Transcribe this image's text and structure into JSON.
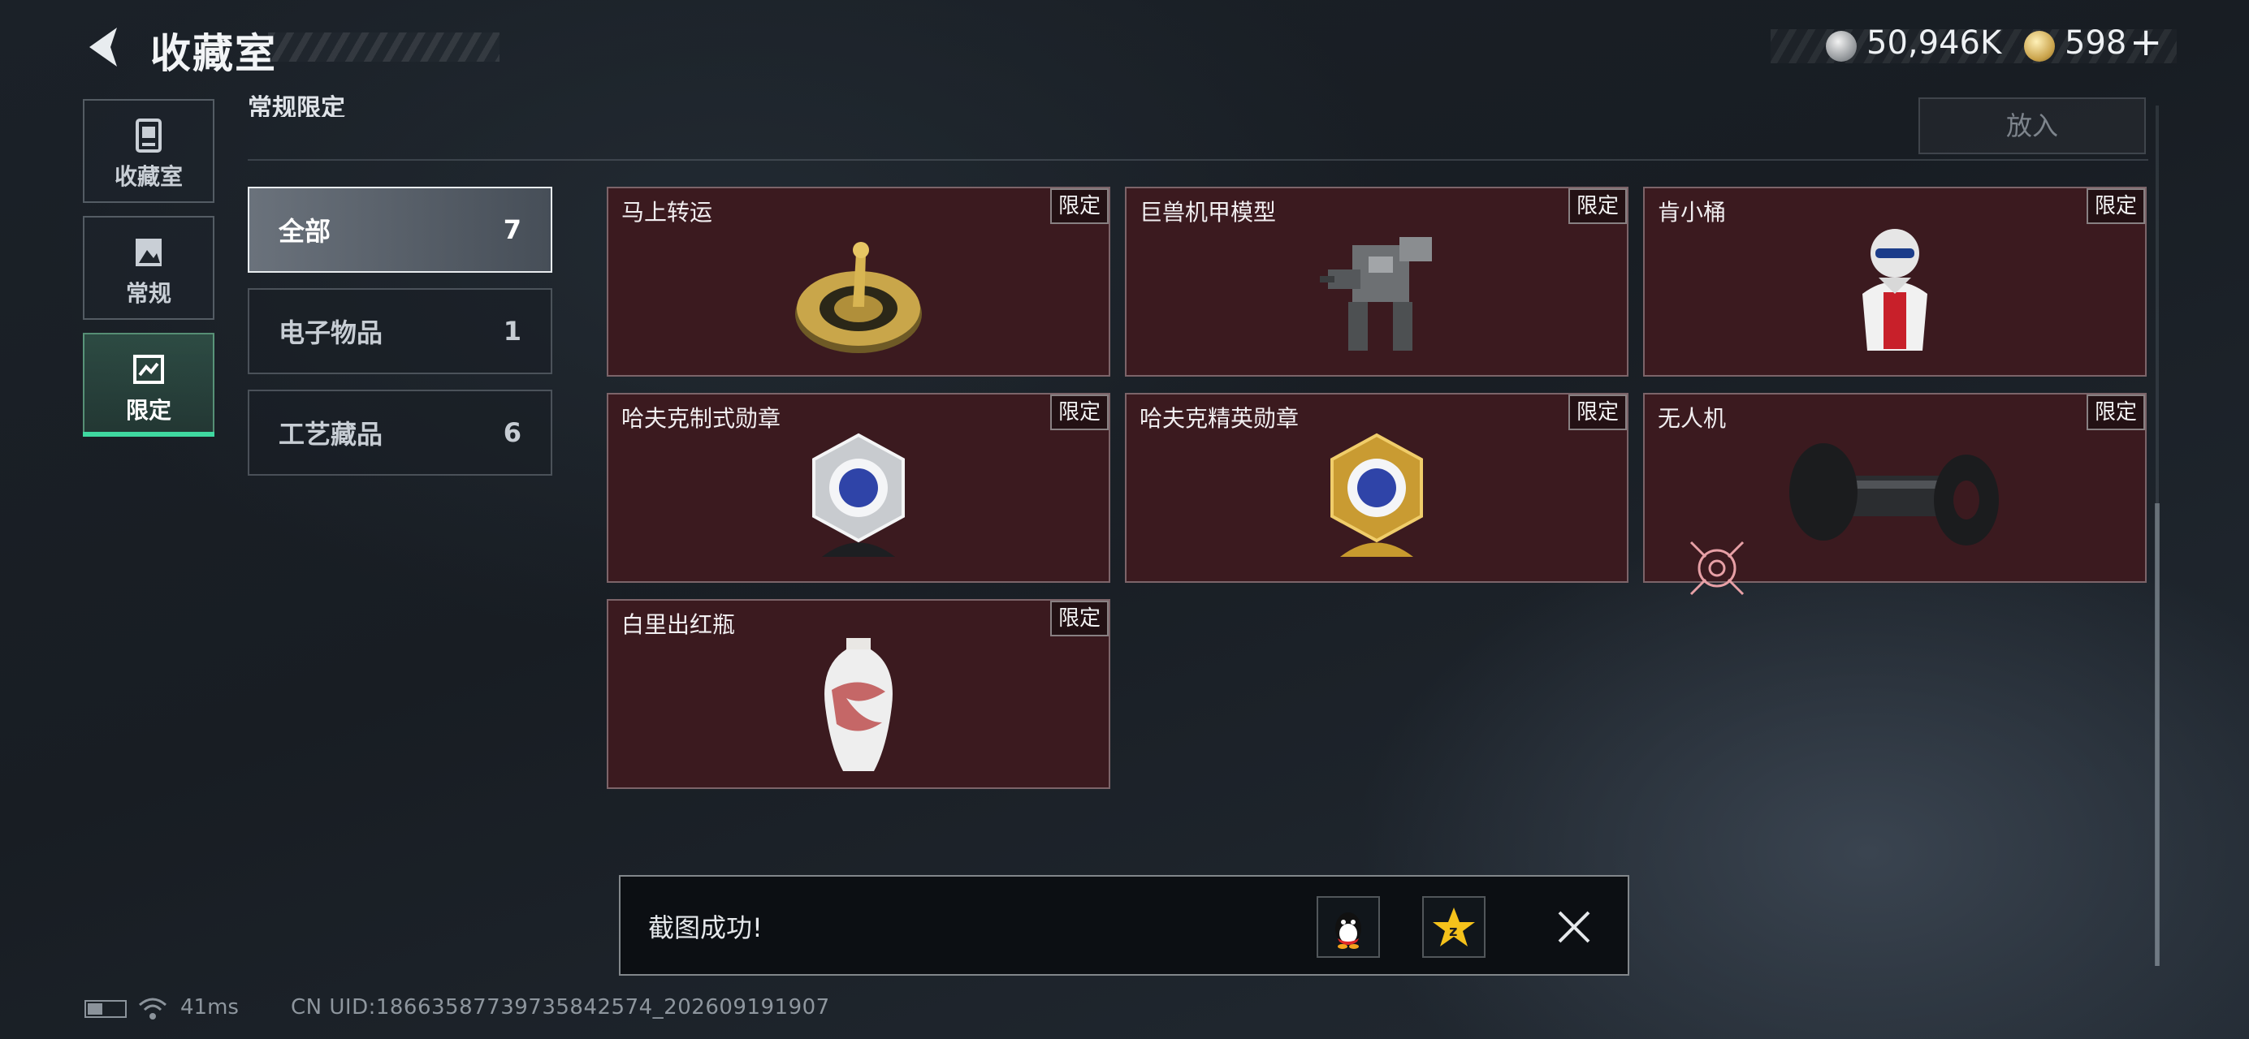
{
  "header": {
    "title": "收藏室",
    "currency": {
      "silver": "50,946K",
      "gold": "598",
      "plus": "+"
    }
  },
  "nav": [
    {
      "label": "收藏室"
    },
    {
      "label": "常规"
    },
    {
      "label": "限定"
    }
  ],
  "section": {
    "title": "常规限定",
    "put_label": "放入"
  },
  "categories": [
    {
      "label": "全部",
      "count": "7"
    },
    {
      "label": "电子物品",
      "count": "1"
    },
    {
      "label": "工艺藏品",
      "count": "6"
    }
  ],
  "items": [
    {
      "name": "马上转运",
      "tag": "限定",
      "icon": "golden-compass-icon"
    },
    {
      "name": "巨兽机甲模型",
      "tag": "限定",
      "icon": "mech-model-icon"
    },
    {
      "name": "肯小桶",
      "tag": "限定",
      "icon": "colonel-figure-icon"
    },
    {
      "name": "哈夫克制式勋章",
      "tag": "限定",
      "icon": "silver-medal-icon"
    },
    {
      "name": "哈夫克精英勋章",
      "tag": "限定",
      "icon": "gold-medal-icon"
    },
    {
      "name": "无人机",
      "tag": "限定",
      "icon": "drone-icon"
    },
    {
      "name": "白里出红瓶",
      "tag": "限定",
      "icon": "porcelain-vase-icon"
    }
  ],
  "toast": {
    "message": "截图成功!"
  },
  "status": {
    "ping": "41ms",
    "uid": "CN UID:1866358773973584257­4_202609191907"
  },
  "colors": {
    "accent_green": "#3fd8a0",
    "card_bg": "#3b1a1f"
  }
}
